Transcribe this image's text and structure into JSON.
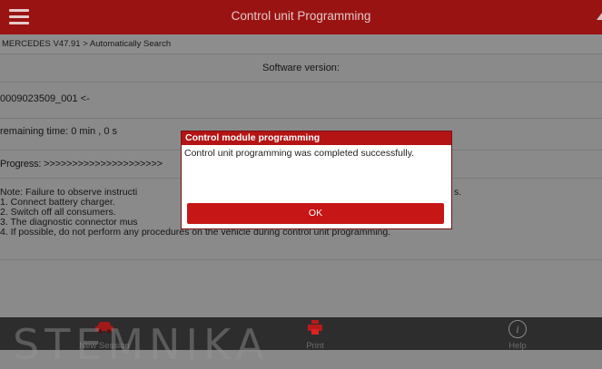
{
  "app": {
    "title": "Control unit Programming"
  },
  "breadcrumb": "MERCEDES V47.91 > Automatically Search",
  "software": {
    "header": "Software version:",
    "version": "0009023509_001  <-",
    "remaining": "remaining time: 0 min , 0 s",
    "progress": "Progress: >>>>>>>>>>>>>>>>>>>>>"
  },
  "note": {
    "lines": [
      "Note: Failure to observe instructi",
      "1. Connect battery charger.",
      "2. Switch off all consumers.",
      "3. The diagnostic connector mus",
      "4. If possible, do not perform any procedures on the vehicle during control unit programming."
    ],
    "tail": "s."
  },
  "dialog": {
    "title": "Control module programming",
    "message": "Control unit programming was completed successfully.",
    "ok_label": "OK"
  },
  "bottom": {
    "new_session": "New Session",
    "print": "Print",
    "help": "Help"
  },
  "watermark": "STEMNIKA",
  "colors": {
    "header": "#9a1313",
    "accent": "#c61616"
  }
}
